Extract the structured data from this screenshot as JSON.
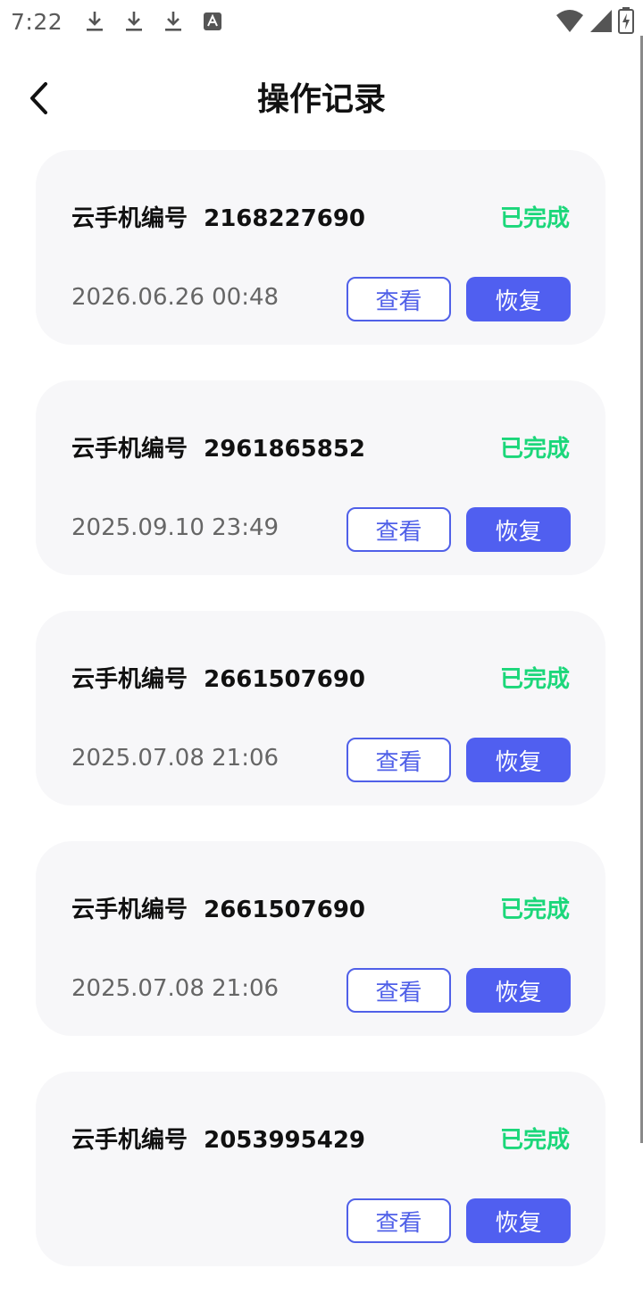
{
  "status_bar": {
    "time": "7:22",
    "notification_icons": [
      "download-icon",
      "download-icon",
      "download-icon",
      "text-a-icon"
    ],
    "right_icons": [
      "wifi-icon",
      "signal-icon",
      "battery-charging-icon"
    ]
  },
  "header": {
    "title": "操作记录",
    "back_icon": "chevron-left-icon"
  },
  "records": [
    {
      "title": "云手机编号  2168227690",
      "status": "已完成",
      "time": "2026.06.26 00:48",
      "view_label": "查看",
      "restore_label": "恢复"
    },
    {
      "title": "云手机编号  2961865852",
      "status": "已完成",
      "time": "2025.09.10 23:49",
      "view_label": "查看",
      "restore_label": "恢复"
    },
    {
      "title": "云手机编号  2661507690",
      "status": "已完成",
      "time": "2025.07.08 21:06",
      "view_label": "查看",
      "restore_label": "恢复"
    },
    {
      "title": "云手机编号  2661507690",
      "status": "已完成",
      "time": "2025.07.08 21:06",
      "view_label": "查看",
      "restore_label": "恢复"
    },
    {
      "title": "云手机编号  2053995429",
      "status": "已完成",
      "time": "",
      "view_label": "查看",
      "restore_label": "恢复"
    }
  ],
  "colors": {
    "status_complete": "#1bd77a",
    "accent": "#505ff0",
    "card_bg": "#f7f7f9"
  }
}
